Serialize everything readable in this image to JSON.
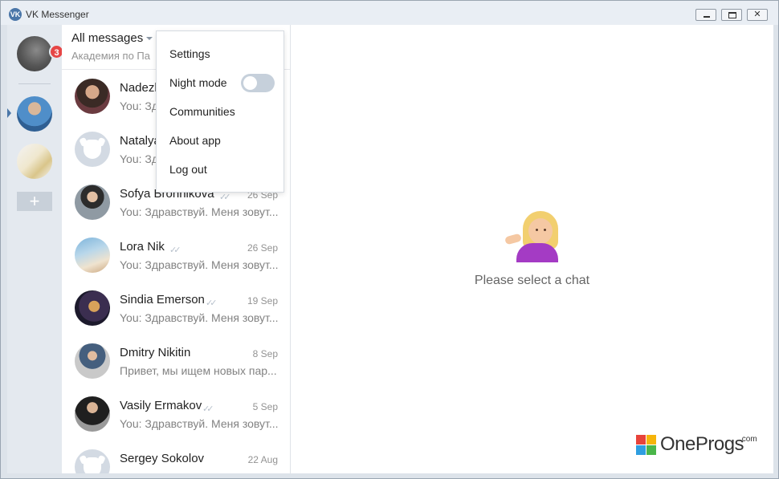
{
  "window": {
    "title": "VK Messenger",
    "logo_text": "VK"
  },
  "rail": {
    "badge_count": "3",
    "add_account_label": "+"
  },
  "list_header": {
    "title": "All messages",
    "subtitle": "Академия по Па"
  },
  "conversations": [
    {
      "name": "Nadezh",
      "date": "",
      "preview": "You: Здравс",
      "read": false,
      "avatar": "photo"
    },
    {
      "name": "Natalya",
      "date": "",
      "preview": "You: Здравс",
      "read": false,
      "avatar": "default"
    },
    {
      "name": "Sofya Bronnikova",
      "date": "26 Sep",
      "preview": "You: Здравствуй. Меня зовут...",
      "read": true,
      "avatar": "photo"
    },
    {
      "name": "Lora Nik",
      "date": "26 Sep",
      "preview": "You: Здравствуй. Меня зовут...",
      "read": true,
      "avatar": "photo"
    },
    {
      "name": "Sindia Emerson",
      "date": "19 Sep",
      "preview": "You: Здравствуй. Меня зовут...",
      "read": true,
      "avatar": "photo"
    },
    {
      "name": "Dmitry Nikitin",
      "date": "8 Sep",
      "preview": "Привет, мы ищем новых пар...",
      "read": false,
      "avatar": "photo"
    },
    {
      "name": "Vasily Ermakov",
      "date": "5 Sep",
      "preview": "You: Здравствуй. Меня зовут...",
      "read": true,
      "avatar": "photo"
    },
    {
      "name": "Sergey Sokolov",
      "date": "22 Aug",
      "preview": "",
      "read": false,
      "avatar": "default"
    }
  ],
  "read_mark": "✓✓",
  "menu": {
    "items": [
      "Settings",
      "Night mode",
      "Communities",
      "About app",
      "Log out"
    ],
    "night_mode_enabled": false
  },
  "chat": {
    "empty_text": "Please select a chat"
  },
  "watermark": {
    "name": "OneProgs",
    "suffix": ".com",
    "colors": [
      "#e8433a",
      "#f5b40a",
      "#2f9ee0",
      "#4ab649"
    ]
  }
}
